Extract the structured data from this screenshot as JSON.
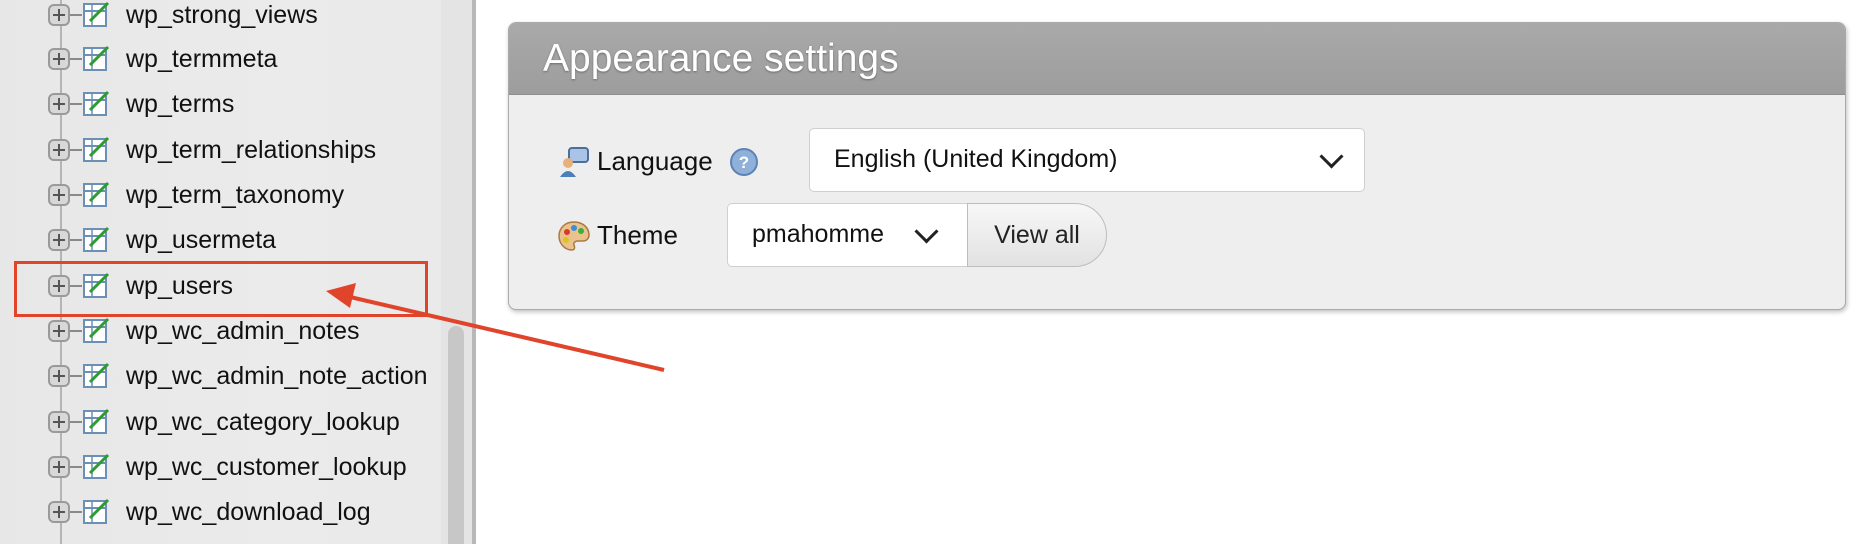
{
  "navigation": {
    "tables": [
      {
        "label": "wp_strong_views"
      },
      {
        "label": "wp_termmeta"
      },
      {
        "label": "wp_terms"
      },
      {
        "label": "wp_term_relationships"
      },
      {
        "label": "wp_term_taxonomy"
      },
      {
        "label": "wp_usermeta"
      },
      {
        "label": "wp_users"
      },
      {
        "label": "wp_wc_admin_notes"
      },
      {
        "label": "wp_wc_admin_note_action"
      },
      {
        "label": "wp_wc_category_lookup"
      },
      {
        "label": "wp_wc_customer_lookup"
      },
      {
        "label": "wp_wc_download_log"
      }
    ],
    "highlighted_table": "wp_users"
  },
  "appearance_panel": {
    "title": "Appearance settings",
    "language": {
      "label": "Language",
      "help_icon": "help-icon",
      "selected": "English (United Kingdom)"
    },
    "theme": {
      "label": "Theme",
      "selected": "pmahomme",
      "view_all_label": "View all"
    }
  },
  "colors": {
    "annotation": "#e0452b",
    "panel_header": "#a3a3a3"
  }
}
